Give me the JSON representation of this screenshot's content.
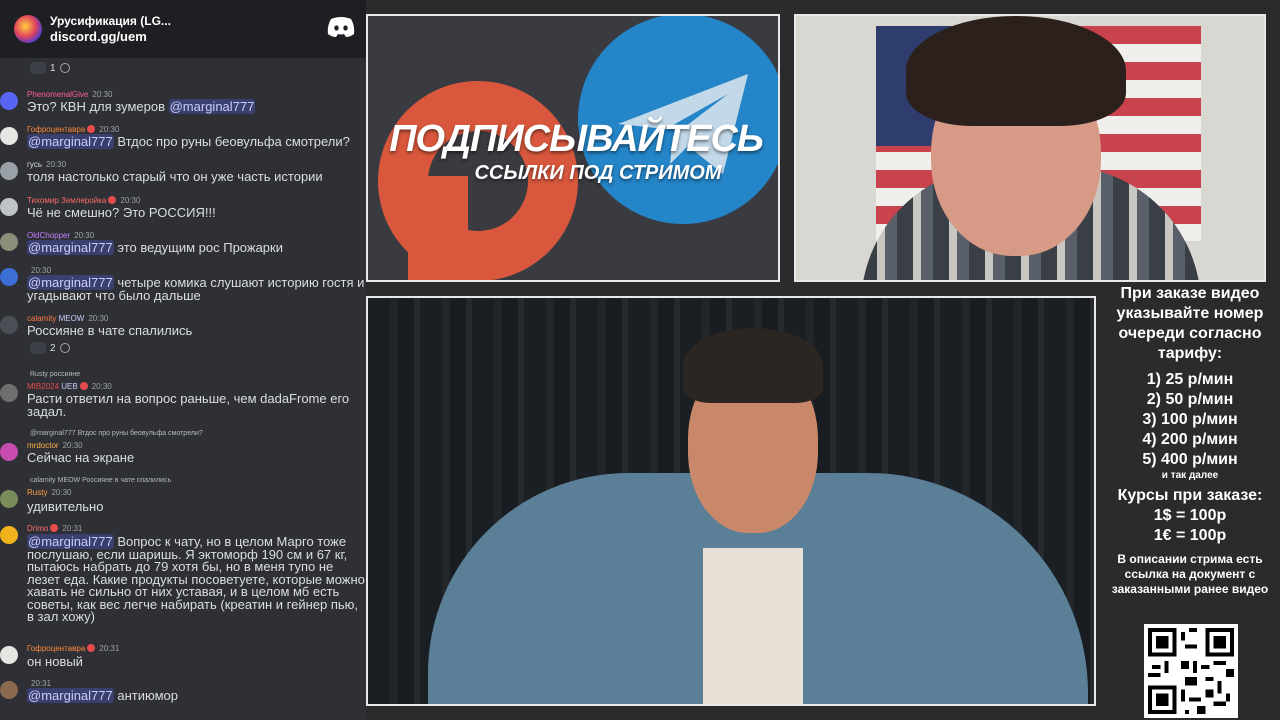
{
  "server": {
    "name": "Урусификация (LG...",
    "invite": "discord.gg/uem",
    "icon": "discord-icon"
  },
  "top_reaction": {
    "count": "1"
  },
  "messages": [
    {
      "user": "PhenomenalGive",
      "user_color": "#ff5d8f",
      "time": "20:30",
      "text_pre": "Это? КВН для зумеров ",
      "mention": "@marginal777",
      "text_post": ""
    },
    {
      "user": "Гофроцентавра",
      "user_color": "#ff8a3d",
      "time": "20:30",
      "text_pre": "",
      "mention": "@marginal777",
      "text_post": " Втдос про руны беовульфа смотрели?"
    },
    {
      "user": "гусь",
      "user_color": "#dbdee1",
      "time": "20:30",
      "text_pre": "толя настолько старый что он уже часть истории",
      "mention": "",
      "text_post": ""
    },
    {
      "user": "Тихомир Землеройка",
      "user_color": "#ff6b6b",
      "time": "20:30",
      "text_pre": "Чё не смешно? Это РОССИЯ!!!",
      "mention": "",
      "text_post": ""
    },
    {
      "user": "OldChopper",
      "user_color": "#c77dff",
      "time": "20:30",
      "text_pre": "",
      "mention": "@marginal777",
      "text_post": " это ведущим рос Прожарки"
    },
    {
      "user": "",
      "user_color": "#9b84ff",
      "time": "20:30",
      "text_pre": "",
      "mention": "@marginal777",
      "text_post": " четыре комика слушают историю гостя и угадывают что было дальше"
    },
    {
      "user": "calamity",
      "user_color": "#ff7a45",
      "time": "20:30",
      "tag": "MEOW",
      "text_pre": "Россияне в чате спалились",
      "mention": "",
      "text_post": ""
    },
    {
      "user": "MIB2024",
      "user_color": "#e84b4b",
      "time": "20:30",
      "tag": "UEB",
      "reply": "Rusty россияне",
      "text_pre": "Расти ответил на вопрос раньше, чем dadaFrome его задал.",
      "mention": "",
      "text_post": ""
    },
    {
      "user": "mrdoctor",
      "user_color": "#ffb347",
      "time": "20:30",
      "reply": "@marginal777 Втдос про руны беовульфа смотрели?",
      "text_pre": "Сейчас на экране",
      "mention": "",
      "text_post": ""
    },
    {
      "user": "Rusty",
      "user_color": "#ff9f43",
      "time": "20:30",
      "reply": "calamity MEOW Россияне в чате спалились",
      "text_pre": "удивительно",
      "mention": "",
      "text_post": ""
    },
    {
      "user": "Drimo",
      "user_color": "#ff6b6b",
      "time": "20:31",
      "text_pre": "",
      "mention": "@marginal777",
      "text_post": " Вопрос к чату, но в целом Марго тоже послушаю, если шаришь. Я эктоморф 190 см и 67 кг, пытаюсь набрать до 79 хотя бы, но в меня тупо не лезет еда. Какие продукты посоветуете, которые можно хавать не сильно от них уставая, и в целом мб есть советы, как вес легче набирать (креатин и гейнер пью, в зал хожу)"
    },
    {
      "user": "Гофроцентавра",
      "user_color": "#ff8a3d",
      "time": "20:31",
      "text_pre": "он новый",
      "mention": "",
      "text_post": ""
    },
    {
      "user": "",
      "user_color": "#dbdee1",
      "time": "20:31",
      "text_pre": "",
      "mention": "@marginal777",
      "text_post": " антиюмор"
    }
  ],
  "reactions": {
    "r1": "1",
    "r2": "2"
  },
  "promo": {
    "title": "ПОДПИСЫВАЙТЕСЬ",
    "subtitle": "ССЫЛКИ ПОД СТРИМОМ"
  },
  "info": {
    "intro": "При заказе видео указывайте номер очереди согласно тарифу:",
    "tariffs": [
      "1) 25 р/мин",
      "2) 50 р/мин",
      "3) 100 р/мин",
      "4) 200 р/мин",
      "5) 400 р/мин"
    ],
    "etc": "и так далее",
    "rates_title": "Курсы при заказе:",
    "rates": [
      "1$ = 100р",
      "1€ = 100р"
    ],
    "note": "В описании стрима есть ссылка на документ с заказанными ранее видео"
  },
  "colors": {
    "chat_bg": "#2e3035",
    "mention": "#c9cdfb",
    "telegram": "#2485c8",
    "patreon": "#d9583d"
  }
}
